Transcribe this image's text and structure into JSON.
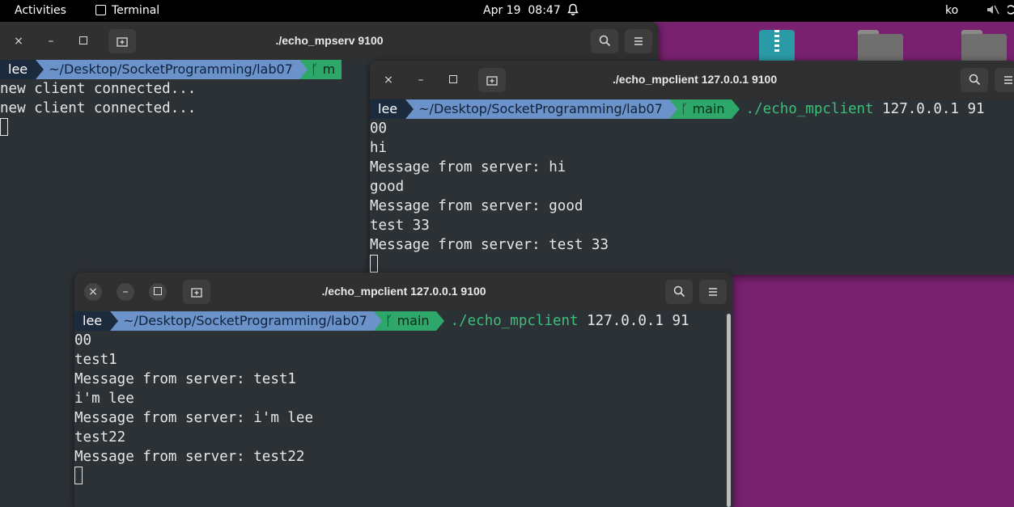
{
  "topbar": {
    "activities": "Activities",
    "app_name": "Terminal",
    "date": "Apr 19",
    "time": "08:47",
    "lang": "ko"
  },
  "prompt": {
    "user": "lee",
    "path": "~/Desktop/SocketProgramming/lab07",
    "branch": "main",
    "branch_partial": "m"
  },
  "windows": {
    "server": {
      "title": "./echo_mpserv 9100",
      "lines": [
        "new client connected...",
        "new client connected..."
      ]
    },
    "client1": {
      "title": "./echo_mpclient 127.0.0.1 9100",
      "cmd": "./echo_mpclient",
      "args": " 127.0.0.1 91",
      "wrap": "00",
      "lines": [
        "hi",
        "Message from server: hi",
        "good",
        "Message from server: good",
        "test 33",
        "Message from server: test 33"
      ]
    },
    "client2": {
      "title": "./echo_mpclient 127.0.0.1 9100",
      "cmd": "./echo_mpclient",
      "args": " 127.0.0.1 91",
      "wrap": "00",
      "lines": [
        "test1",
        "Message from server: test1",
        "i'm lee",
        "Message from server: i'm lee",
        "test22",
        "Message from server: test22"
      ]
    }
  },
  "icons": {
    "close": "×",
    "minimize": "–",
    "maximize": "□",
    "new_tab": "⊞",
    "search": "⌕",
    "menu": "≡",
    "bell": "bell-icon",
    "volume": "volume-muted-icon"
  }
}
